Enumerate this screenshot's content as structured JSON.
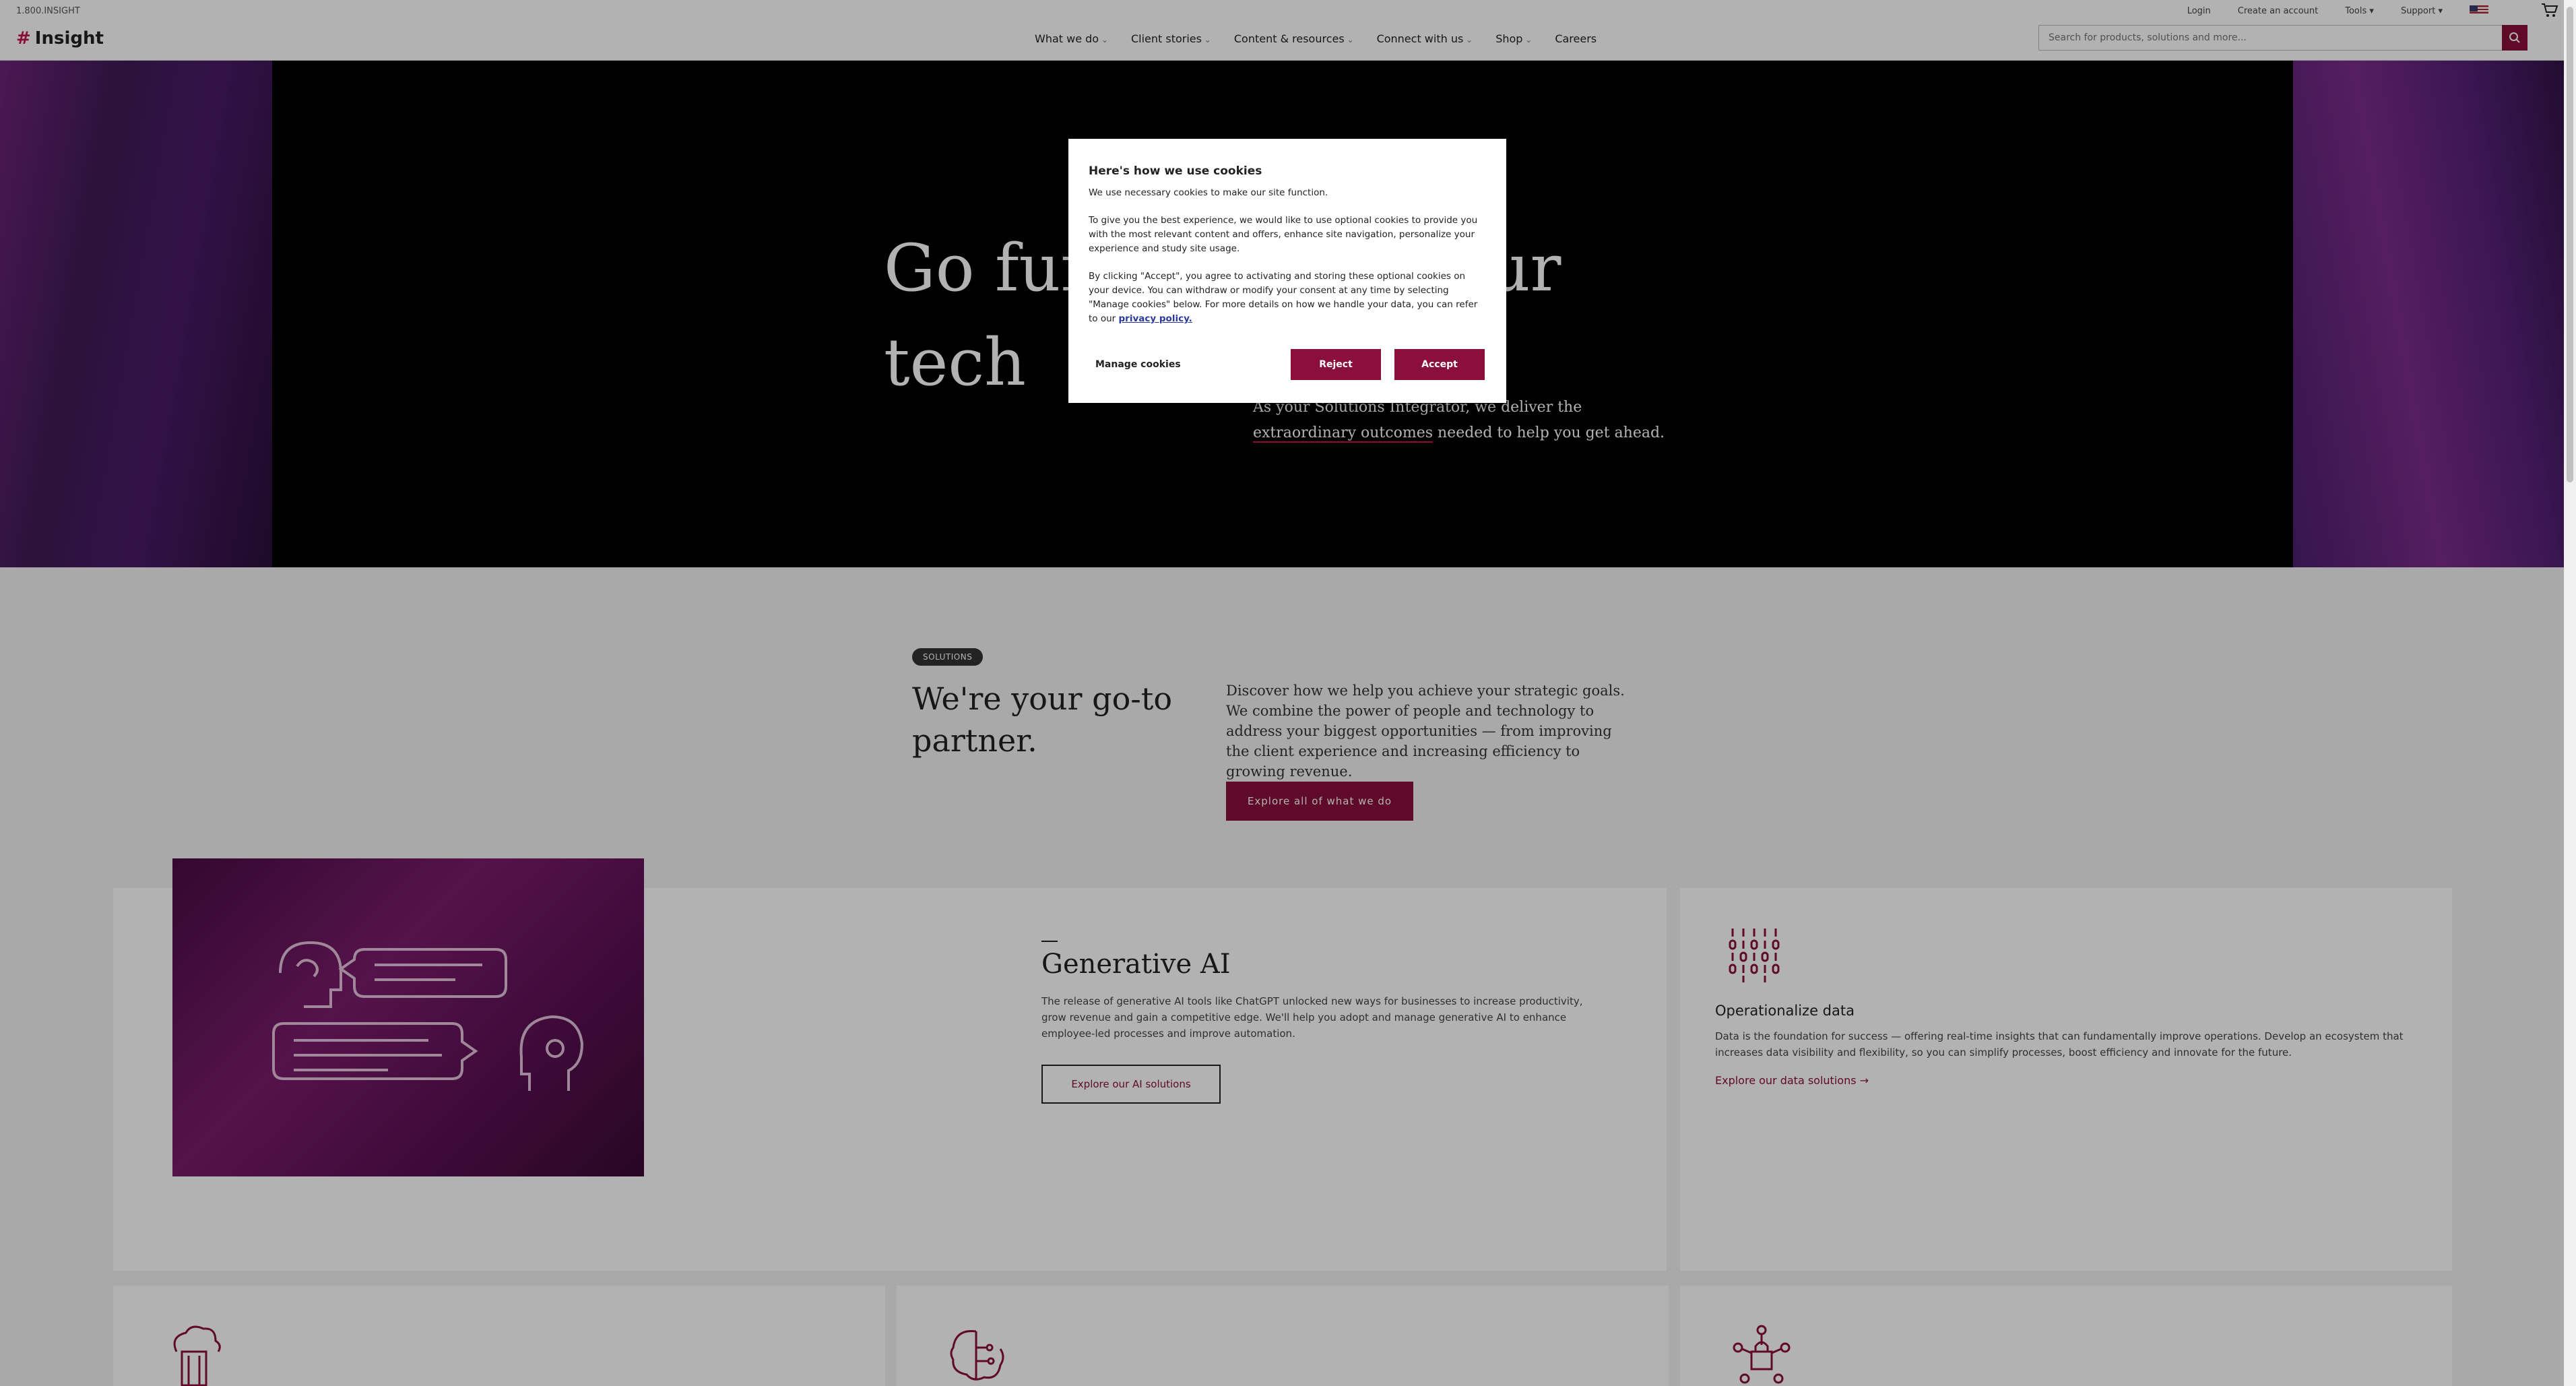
{
  "topbar": {
    "phone": "1.800.INSIGHT",
    "links": [
      "Login",
      "Create an account",
      "Tools ▾",
      "Support ▾"
    ],
    "flag_icon": "us-flag-icon",
    "cart_icon": "cart-icon"
  },
  "brand": {
    "logo_text": "Insight",
    "logo_mark": "#"
  },
  "nav": {
    "items": [
      "What we do",
      "Client stories",
      "Content & resources",
      "Connect with us",
      "Shop",
      "Careers"
    ],
    "search_placeholder": "Search for products, solutions and more..."
  },
  "hero": {
    "headline": "Go further with your tech",
    "sub_before": "As your Solutions Integrator, we deliver the",
    "sub_link": "extraordinary outcomes",
    "sub_after": " needed to help you get ahead."
  },
  "solutions": {
    "badge": "SOLUTIONS",
    "title": "We're your go-to partner.",
    "text": "Discover how we help you achieve your strategic goals. We combine the power of people and technology to address your biggest opportunities — from improving the client experience and increasing efficiency to growing revenue.",
    "cta": "Explore all of what we do"
  },
  "ai_card": {
    "title": "Generative AI",
    "text": "The release of generative AI tools like ChatGPT unlocked new ways for businesses to increase productivity, grow revenue and gain a competitive edge. We'll help you adopt and manage generative AI to enhance employee-led processes and improve automation.",
    "cta": "Explore our AI solutions"
  },
  "data_card": {
    "title": "Operationalize data",
    "text": "Data is the foundation for success — offering real-time insights that can fundamentally improve operations. Develop an ecosystem that increases data visibility and flexibility, so you can simplify processes, boost efficiency and innovate for the future.",
    "link": "Explore our data solutions →"
  },
  "cookie": {
    "title": "Here's how we use cookies",
    "p1": "We use necessary cookies to make our site function.",
    "p2": "To give you the best experience, we would like to use optional cookies to provide you with the most relevant content and offers, enhance site navigation, personalize your experience and study site usage.",
    "p3": "By clicking \"Accept\", you agree to activating and storing these optional cookies on your device. You can withdraw or modify your consent at any time by selecting \"Manage cookies\" below. For more details on how we handle your data, you can refer to our",
    "privacy_link": "privacy policy.",
    "manage": "Manage cookies",
    "reject": "Reject",
    "accept": "Accept"
  },
  "colors": {
    "brand": "#8a0f3b",
    "accent": "#c6134d"
  }
}
